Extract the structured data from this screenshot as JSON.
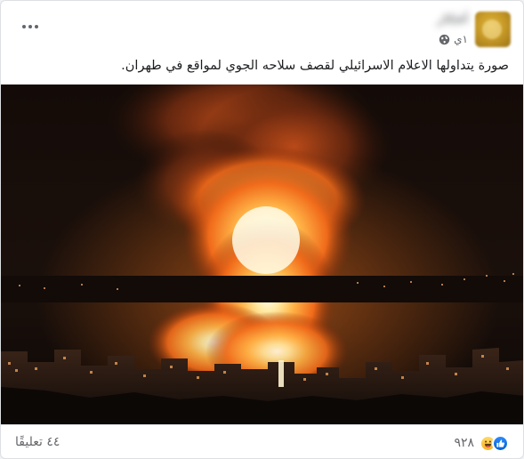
{
  "post": {
    "author_name": "أفكار",
    "timestamp": "١ي",
    "privacy_icon": "globe-icon",
    "menu_icon": "more-icon",
    "caption": "صورة يتداولها الاعلام الاسرائيلي لقصف سلاحه الجوي لمواقع في طهران."
  },
  "footer": {
    "reaction_icons": [
      "like-icon",
      "haha-icon"
    ],
    "reaction_count": "٩٢٨",
    "comments_count": "٤٤ تعليقًا"
  },
  "colors": {
    "text_primary": "#1c1e21",
    "text_secondary": "#65676b",
    "like_blue": "#1877f2",
    "haha_yellow": "#f7b928",
    "fire_core": "#fff6c8",
    "fire_outer": "#e2560f"
  }
}
